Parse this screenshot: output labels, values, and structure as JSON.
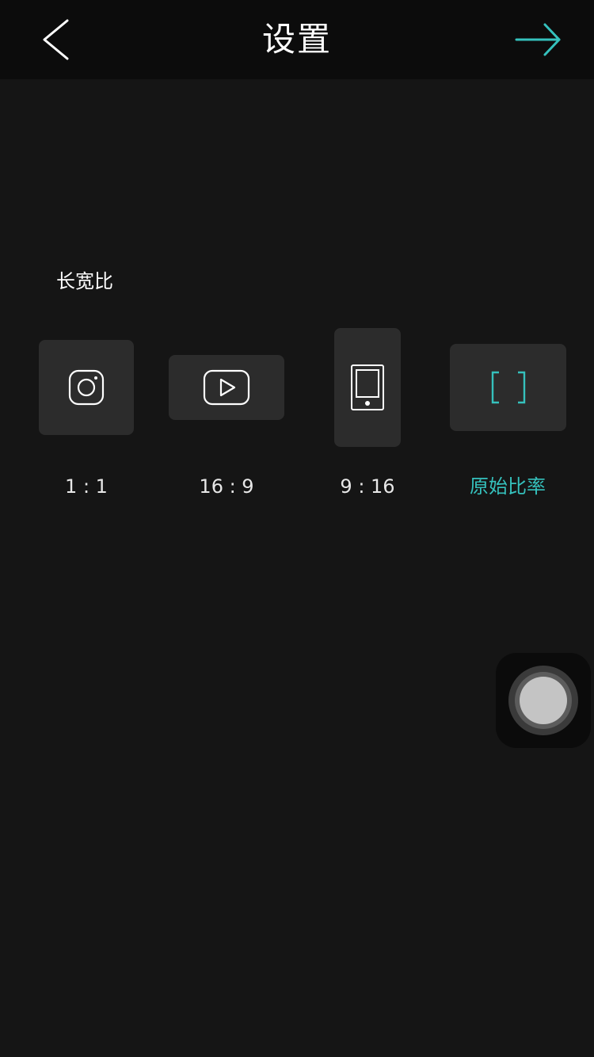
{
  "header": {
    "title": "设置",
    "back_icon": "chevron-left-icon",
    "next_icon": "arrow-right-icon",
    "accent_color": "#35c1bd"
  },
  "aspect_ratio": {
    "section_label": "长宽比",
    "options": [
      {
        "label": "1 : 1",
        "icon": "instagram-icon",
        "selected": false
      },
      {
        "label": "16 : 9",
        "icon": "youtube-icon",
        "selected": false
      },
      {
        "label": "9 : 16",
        "icon": "phone-icon",
        "selected": false
      },
      {
        "label": "原始比率",
        "icon": "original-ratio-brackets-icon",
        "selected": true
      }
    ]
  }
}
